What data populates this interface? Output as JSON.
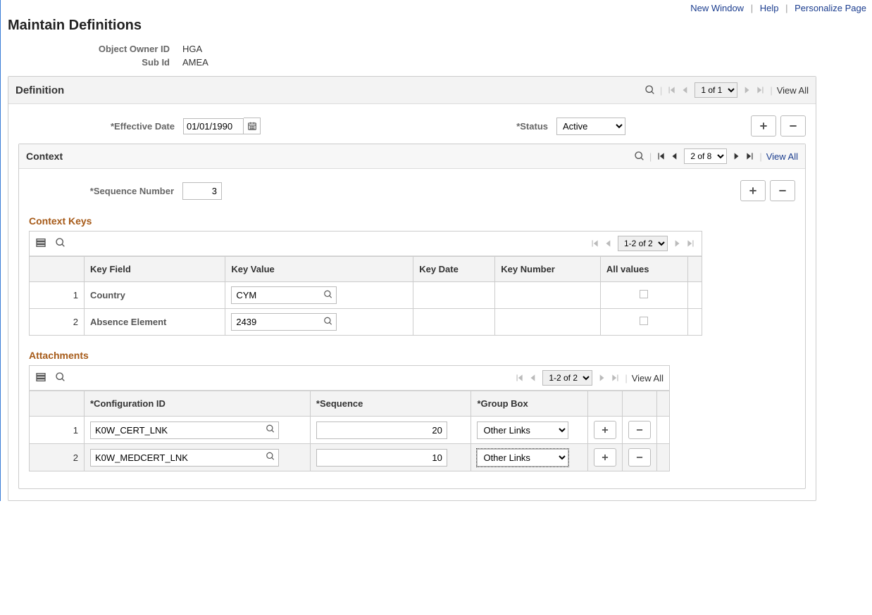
{
  "toplinks": {
    "new_window": "New Window",
    "help": "Help",
    "personalize": "Personalize Page"
  },
  "page_title": "Maintain Definitions",
  "info": {
    "object_owner_id": {
      "label": "Object Owner ID",
      "value": "HGA"
    },
    "sub_id": {
      "label": "Sub Id",
      "value": "AMEA"
    }
  },
  "definition": {
    "title": "Definition",
    "pager": {
      "range": "1 of 1",
      "view_all": "View All"
    },
    "effective_date": {
      "label": "*Effective Date",
      "value": "01/01/1990"
    },
    "status": {
      "label": "*Status",
      "value": "Active"
    }
  },
  "context": {
    "title": "Context",
    "pager": {
      "range": "2 of 8",
      "view_all": "View All"
    },
    "sequence_number": {
      "label": "*Sequence Number",
      "value": "3"
    }
  },
  "context_keys": {
    "title": "Context Keys",
    "pager": {
      "range": "1-2 of 2"
    },
    "columns": {
      "key_field": "Key Field",
      "key_value": "Key Value",
      "key_date": "Key Date",
      "key_number": "Key Number",
      "all_values": "All values"
    },
    "rows": [
      {
        "n": "1",
        "field": "Country",
        "value": "CYM"
      },
      {
        "n": "2",
        "field": "Absence Element",
        "value": "2439"
      }
    ]
  },
  "attachments": {
    "title": "Attachments",
    "pager": {
      "range": "1-2 of 2",
      "view_all": "View All"
    },
    "columns": {
      "config_id": "*Configuration ID",
      "sequence": "*Sequence",
      "group_box": "*Group Box"
    },
    "rows": [
      {
        "n": "1",
        "config": "K0W_CERT_LNK",
        "seq": "20",
        "group": "Other Links"
      },
      {
        "n": "2",
        "config": "K0W_MEDCERT_LNK",
        "seq": "10",
        "group": "Other Links"
      }
    ]
  }
}
